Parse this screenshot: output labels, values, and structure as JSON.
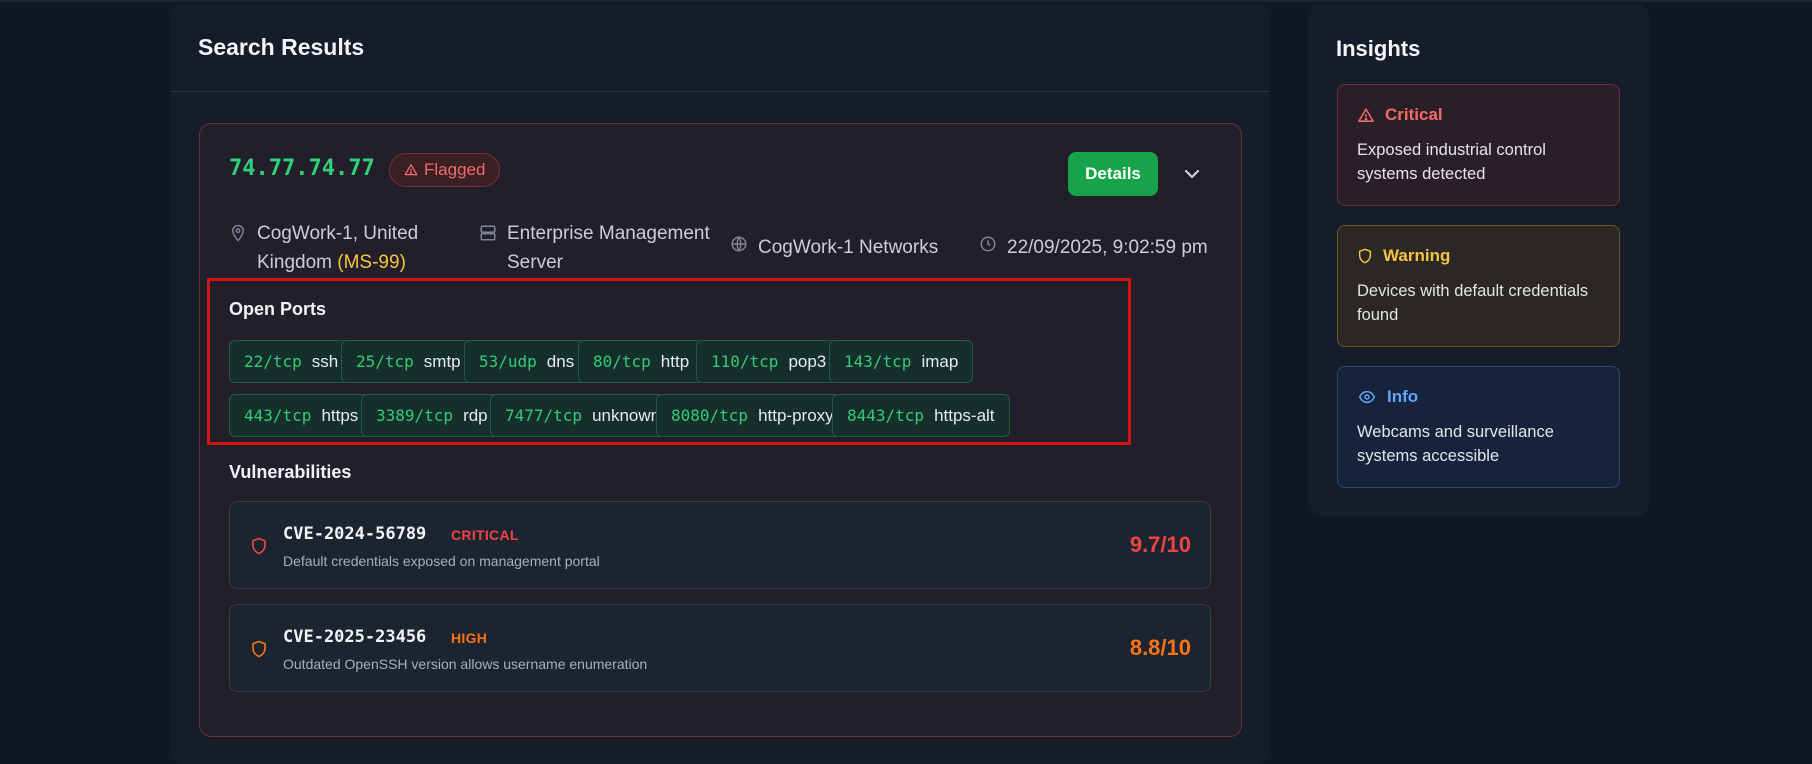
{
  "results": {
    "title": "Search Results",
    "host": {
      "ip": "74.77.74.77",
      "flag_label": "Flagged",
      "details_label": "Details",
      "location": "CogWork-1, United Kingdom",
      "location_line1": "CogWork-1, United",
      "location_line2": "Kingdom",
      "region_code": "(MS-99)",
      "device_line1": "Enterprise Management",
      "device_line2": "Server",
      "org": "CogWork-1 Networks",
      "timestamp": "22/09/2025, 9:02:59 pm"
    },
    "open_ports_title": "Open Ports",
    "ports": [
      {
        "port": "22/tcp",
        "service": "ssh"
      },
      {
        "port": "25/tcp",
        "service": "smtp"
      },
      {
        "port": "53/udp",
        "service": "dns"
      },
      {
        "port": "80/tcp",
        "service": "http"
      },
      {
        "port": "110/tcp",
        "service": "pop3"
      },
      {
        "port": "143/tcp",
        "service": "imap"
      },
      {
        "port": "443/tcp",
        "service": "https"
      },
      {
        "port": "3389/tcp",
        "service": "rdp"
      },
      {
        "port": "7477/tcp",
        "service": "unknown"
      },
      {
        "port": "8080/tcp",
        "service": "http-proxy"
      },
      {
        "port": "8443/tcp",
        "service": "https-alt"
      }
    ],
    "vulnerabilities_title": "Vulnerabilities",
    "vulnerabilities": [
      {
        "cve": "CVE-2024-56789",
        "severity": "CRITICAL",
        "description": "Default credentials exposed on management portal",
        "score": "9.7/10",
        "color": "#ef4444"
      },
      {
        "cve": "CVE-2025-23456",
        "severity": "HIGH",
        "description": "Outdated OpenSSH version allows username enumeration",
        "score": "8.8/10",
        "color": "#f97316"
      }
    ]
  },
  "insights": {
    "title": "Insights",
    "cards": [
      {
        "level": "Critical",
        "text_line1": "Exposed industrial control",
        "text_line2": "systems detected",
        "color": "#f06a6a",
        "icon": "warning-triangle-icon"
      },
      {
        "level": "Warning",
        "text_line1": "Devices with default credentials",
        "text_line2": "found",
        "color": "#f5c542",
        "icon": "shield-icon"
      },
      {
        "level": "Info",
        "text_line1": "Webcams and surveillance",
        "text_line2": "systems accessible",
        "color": "#60a5fa",
        "icon": "eye-icon"
      }
    ]
  },
  "colors": {
    "background": "#0f1723",
    "panel": "#151d2b",
    "accent_green": "#16a34a",
    "ip_green": "#2fd07a",
    "highlight_red": "#d41414"
  }
}
